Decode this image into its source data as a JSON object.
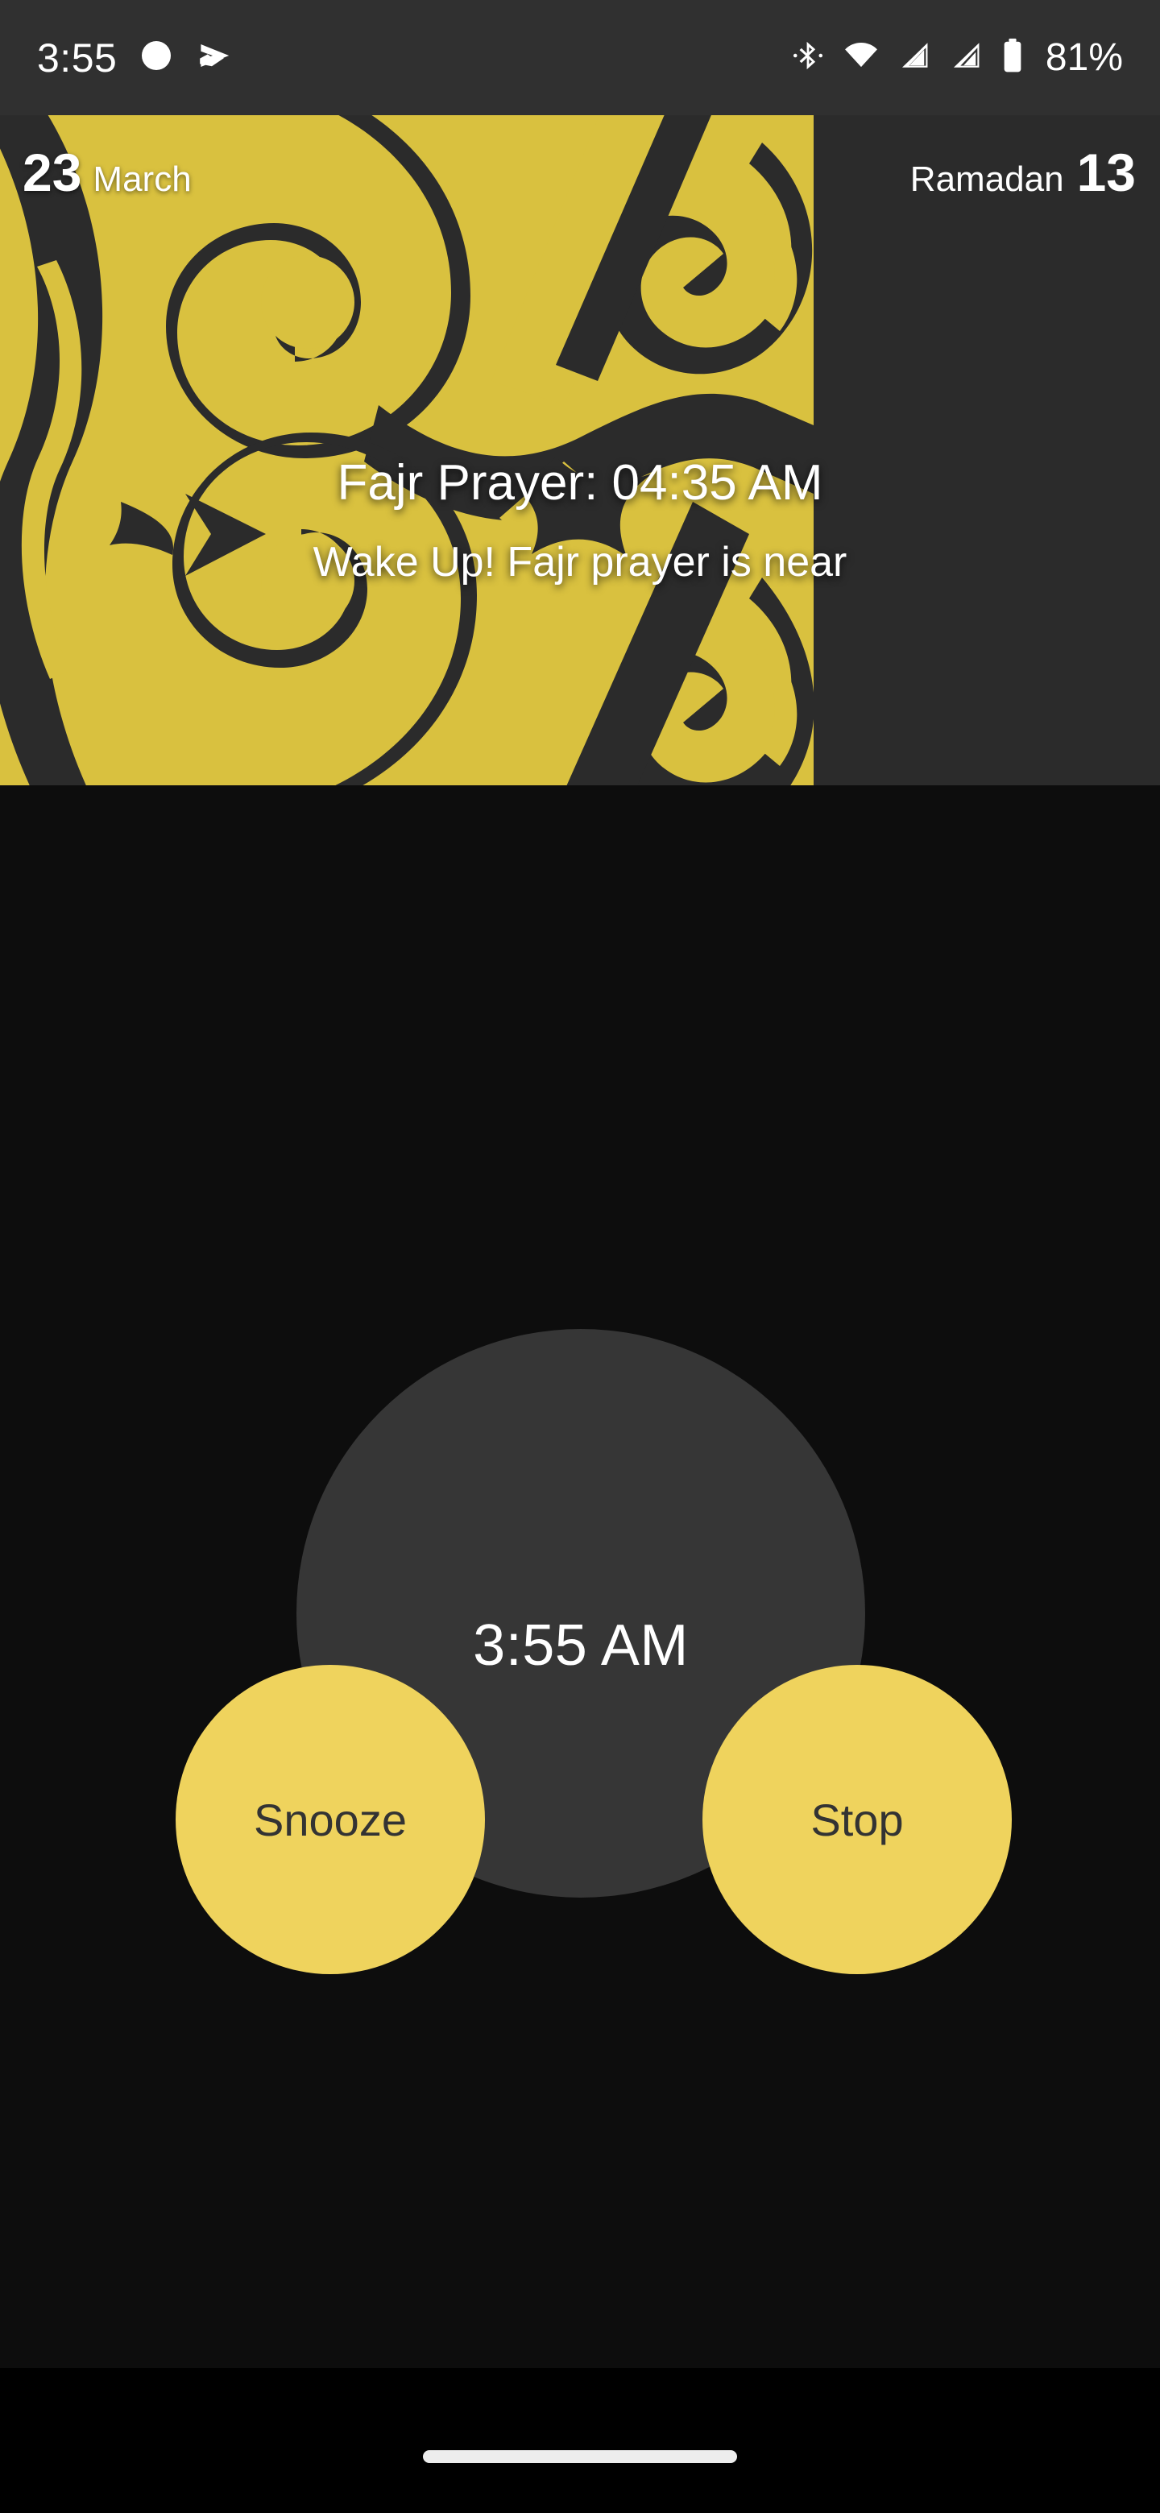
{
  "status_bar": {
    "time": "3:55",
    "battery_percent": "81%",
    "icons": [
      "dnd-moon-icon",
      "app-notification-icon",
      "bluetooth-icon",
      "wifi-icon",
      "signal-sim1-icon",
      "signal-sim2-icon",
      "battery-icon"
    ],
    "background_color": "#303030",
    "text_color": "#FFFFFF"
  },
  "banner": {
    "gregorian_day": "23",
    "gregorian_month": "March",
    "hijri_month": "Ramadan",
    "hijri_day": "13",
    "title": "Fajr Prayer: 04:35 AM",
    "subtitle": "Wake Up! Fajr prayer is near",
    "pattern_color": "#D9C13F",
    "background_color": "#2B2B2B"
  },
  "alarm": {
    "current_time": "3:55 AM",
    "snooze_label": "Snooze",
    "stop_label": "Stop",
    "circle_color": "#363636",
    "accent_color": "#EFD35D",
    "button_text_color": "#333333",
    "background_color": "#0D0D0D"
  },
  "nav_bar": {
    "gesture_pill": "home-gesture-pill",
    "background_color": "#000000"
  }
}
